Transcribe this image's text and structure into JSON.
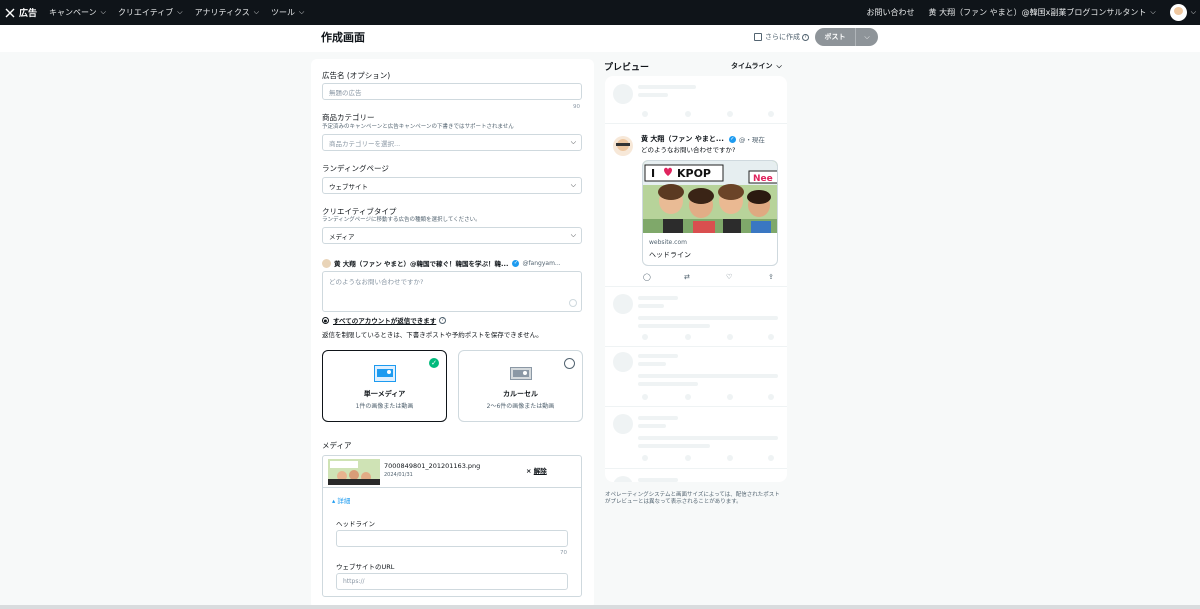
{
  "topnav": {
    "logo_text": "広告",
    "menu": [
      "キャンペーン",
      "クリエイティブ",
      "アナリティクス",
      "ツール"
    ],
    "contact": "お問い合わせ",
    "user_name": "黄 大翔（ファン やまと）@韓国x副業ブログコンサルタント"
  },
  "header": {
    "title": "作成画面",
    "more_create": "さらに作成",
    "post_button": "ポスト"
  },
  "form": {
    "ad_name_label": "広告名 (オプション)",
    "ad_name_placeholder": "無題の広告",
    "ad_name_count": "90",
    "product_label": "商品カテゴリー",
    "product_sub": "予定済みのキャンペーンと広告キャンペーンの下書きではサポートされません",
    "product_placeholder": "商品カテゴリーを選択...",
    "landing_label": "ランディングページ",
    "landing_value": "ウェブサイト",
    "creative_label": "クリエイティブタイプ",
    "creative_sub": "ランディングページに移動する広告の種類を選択してください。",
    "creative_value": "メディア",
    "account_name": "黄 大翔（ファン やまと）@韓国で稼ぐ！韓国を学ぶ！韓...",
    "account_handle": "@fangyam...",
    "tweet_placeholder": "どのようなお問い合わせですか?",
    "reply_link": "すべてのアカウントが返信できます",
    "reply_note": "返信を制限しているときは、下書きポストや予約ポストを保存できません。",
    "single_title": "単一メディア",
    "single_desc": "1件の画像または動画",
    "carousel_title": "カルーセル",
    "carousel_desc": "2〜6件の画像または動画",
    "media_label": "メディア",
    "file_name": "7000849801_201201163.png",
    "file_date": "2024/01/31",
    "remove_label": "解除",
    "detail_label": "詳細",
    "headline_label": "ヘッドライン",
    "headline_count": "70",
    "url_label": "ウェブサイトのURL",
    "url_placeholder": "https://"
  },
  "preview": {
    "title": "プレビュー",
    "timeline": "タイムライン",
    "tweet_name": "黄 大翔（ファン やまと...",
    "tweet_meta": "@・現在",
    "tweet_text": "どのようなお問い合わせですか?",
    "image_caption_1": "I",
    "image_caption_2": "KPOP",
    "image_caption_3": "Nee",
    "card_domain": "website.com",
    "card_headline": "ヘッドライン",
    "note": "オペレーティングシステムと画面サイズによっては、配信されたポストがプレビューとは異なって表示されることがあります。"
  },
  "colors": {
    "nav_bg": "#0f1419",
    "accent": "#1d9bf0",
    "check": "#00ba7c"
  }
}
